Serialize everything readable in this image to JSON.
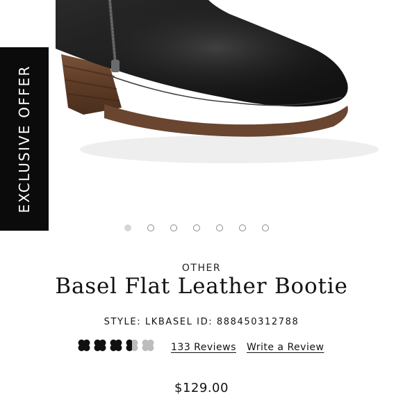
{
  "product": {
    "badge_label": "EXCLUSIVE OFFER",
    "brand": "OTHER",
    "title": "Basel Flat Leather Bootie",
    "style_text": "STYLE: LKBASEL ID: 888450312788",
    "rating": 3.5,
    "rating_max": 5,
    "rating_icon": "clover-icon",
    "reviews_label": "133 Reviews",
    "write_review_label": "Write a Review",
    "price": "$129.00"
  },
  "carousel": {
    "total_slides": 7,
    "active_index": 0
  },
  "colors": {
    "badge_bg": "#0b0b0b",
    "leather": "#1c1c1c",
    "heel": "#6b4630",
    "sole": "#5a3a25",
    "star_filled": "#111111",
    "star_empty": "#bdbdbd"
  }
}
